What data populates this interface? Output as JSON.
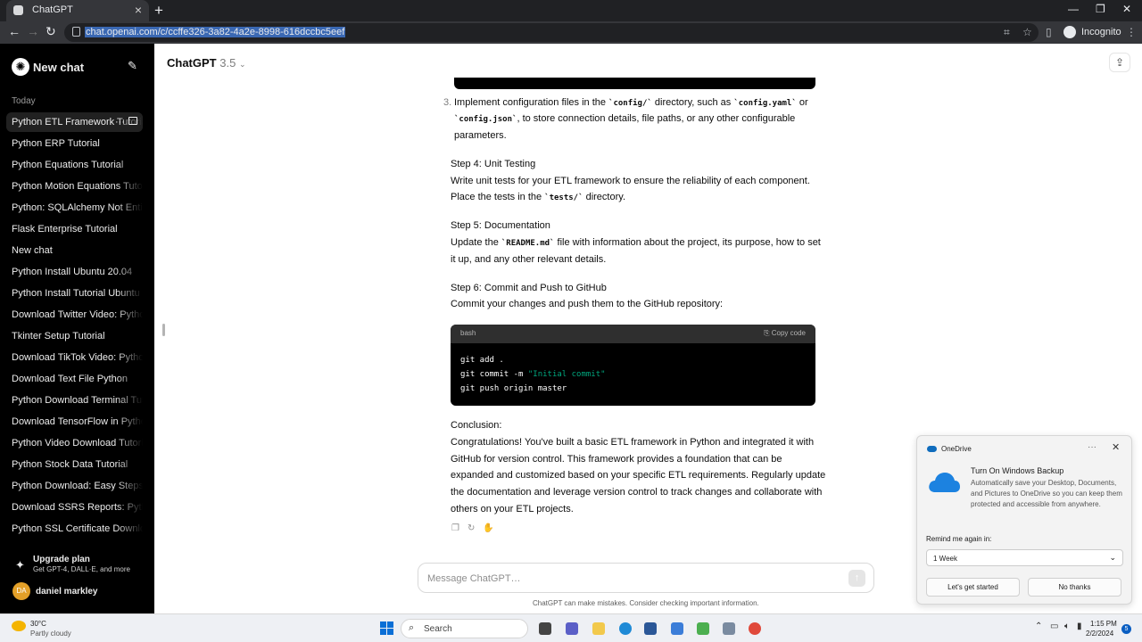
{
  "browser": {
    "tab_title": "ChatGPT",
    "url": "chat.openai.com/c/ccffe326-3a82-4a2e-8998-616dccbc5eef",
    "profile_label": "Incognito"
  },
  "sidebar": {
    "new_chat_label": "New chat",
    "section_today": "Today",
    "items": [
      {
        "label": "Python ETL Framework Tutorial"
      },
      {
        "label": "Python ERP Tutorial"
      },
      {
        "label": "Python Equations Tutorial"
      },
      {
        "label": "Python Motion Equations Tutorial"
      },
      {
        "label": "Python: SQLAlchemy Not Entity"
      },
      {
        "label": "Flask Enterprise Tutorial"
      },
      {
        "label": "New chat"
      },
      {
        "label": "Python Install Ubuntu 20.04"
      },
      {
        "label": "Python Install Tutorial Ubuntu"
      },
      {
        "label": "Download Twitter Video: Python"
      },
      {
        "label": "Tkinter Setup Tutorial"
      },
      {
        "label": "Download TikTok Video: Python"
      },
      {
        "label": "Download Text File Python"
      },
      {
        "label": "Python Download Terminal Tutorial"
      },
      {
        "label": "Download TensorFlow in Python"
      },
      {
        "label": "Python Video Download Tutorial"
      },
      {
        "label": "Python Stock Data Tutorial"
      },
      {
        "label": "Python Download: Easy Steps"
      },
      {
        "label": "Download SSRS Reports: Python"
      },
      {
        "label": "Python SSL Certificate Download"
      }
    ],
    "upgrade_title": "Upgrade plan",
    "upgrade_sub": "Get GPT-4, DALL·E, and more",
    "user_initials": "DA",
    "user_name": "daniel markley"
  },
  "main": {
    "model_name": "ChatGPT",
    "model_version": "3.5",
    "list_item_number": "3.",
    "step3_a": "Implement configuration files in the ",
    "step3_code1": "`config/`",
    "step3_b": " directory, such as ",
    "step3_code2": "`config.yaml`",
    "step3_c": " or",
    "step3_code3": "`config.json`",
    "step3_d": ", to store connection details, file paths, or any other configurable",
    "step3_e": "parameters.",
    "step4_title": "Step 4: Unit Testing",
    "step4_a": "Write unit tests for your ETL framework to ensure the reliability of each component.",
    "step4_b": "Place the tests in the ",
    "step4_code": "`tests/`",
    "step4_c": " directory.",
    "step5_title": "Step 5: Documentation",
    "step5_a": "Update the ",
    "step5_code": "`README.md`",
    "step5_b": " file with information about the project, its purpose, how to set",
    "step5_c": "it up, and any other relevant details.",
    "step6_title": "Step 6: Commit and Push to GitHub",
    "step6_a": "Commit your changes and push them to the GitHub repository:",
    "code_lang": "bash",
    "copy_code_label": "Copy code",
    "code_line1": "git add .",
    "code_line2_a": "git commit -m ",
    "code_line2_str": "\"Initial commit\"",
    "code_line3": "git push origin master",
    "conclusion_title": "Conclusion:",
    "conclusion_lines": [
      "Congratulations! You've built a basic ETL framework in Python and integrated it with",
      "GitHub for version control. This framework provides a foundation that can be",
      "expanded and customized based on your specific ETL requirements. Regularly update",
      "the documentation and leverage version control to track changes and collaborate with",
      "others on your ETL projects."
    ],
    "composer_placeholder": "Message ChatGPT…",
    "disclaimer": "ChatGPT can make mistakes. Consider checking important information."
  },
  "toast": {
    "app_name": "OneDrive",
    "title": "Turn On Windows Backup",
    "body": "Automatically save your Desktop, Documents, and Pictures to OneDrive so you can keep them protected and accessible from anywhere.",
    "remind_label": "Remind me again in:",
    "remind_value": "1 Week",
    "primary_button": "Let's get started",
    "secondary_button": "No thanks"
  },
  "taskbar": {
    "weather_temp": "30°C",
    "weather_desc": "Partly cloudy",
    "search_label": "Search",
    "time": "1:15 PM",
    "date": "2/2/2024",
    "notification_count": "5"
  },
  "icons": {
    "logo": "openai-logo-icon",
    "new_chat": "edit-icon",
    "share": "share-icon",
    "copy": "clipboard-icon"
  }
}
